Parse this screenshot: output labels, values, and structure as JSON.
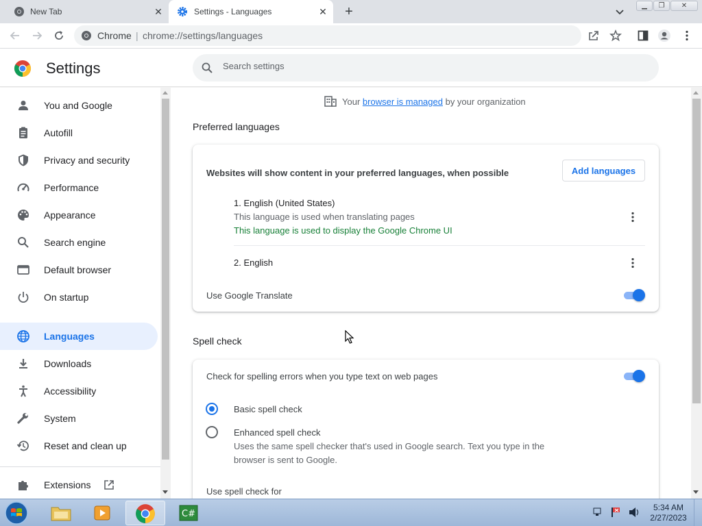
{
  "tabs": [
    {
      "title": "New Tab",
      "icon": "chrome-icon"
    },
    {
      "title": "Settings - Languages",
      "icon": "gear-icon"
    }
  ],
  "omnibox": {
    "site_label": "Chrome",
    "separator": "|",
    "url": "chrome://settings/languages"
  },
  "header": {
    "title": "Settings",
    "search_placeholder": "Search settings"
  },
  "sidebar": {
    "items": [
      {
        "label": "You and Google",
        "icon": "person-icon"
      },
      {
        "label": "Autofill",
        "icon": "clipboard-icon"
      },
      {
        "label": "Privacy and security",
        "icon": "shield-icon"
      },
      {
        "label": "Performance",
        "icon": "speedometer-icon"
      },
      {
        "label": "Appearance",
        "icon": "palette-icon"
      },
      {
        "label": "Search engine",
        "icon": "search-icon"
      },
      {
        "label": "Default browser",
        "icon": "browser-window-icon"
      },
      {
        "label": "On startup",
        "icon": "power-icon"
      },
      {
        "label": "Languages",
        "icon": "globe-icon",
        "active": true
      },
      {
        "label": "Downloads",
        "icon": "download-icon"
      },
      {
        "label": "Accessibility",
        "icon": "accessibility-icon"
      },
      {
        "label": "System",
        "icon": "wrench-icon"
      },
      {
        "label": "Reset and clean up",
        "icon": "history-icon"
      },
      {
        "label": "Extensions",
        "icon": "puzzle-icon"
      }
    ]
  },
  "managed": {
    "prefix": "Your",
    "link": "browser is managed",
    "suffix": "by your organization"
  },
  "preferred_languages": {
    "title": "Preferred languages",
    "description": "Websites will show content in your preferred languages, when possible",
    "add_button": "Add languages",
    "languages": [
      {
        "name": "1. English (United States)",
        "note1": "This language is used when translating pages",
        "note2": "This language is used to display the Google Chrome UI"
      },
      {
        "name": "2. English"
      }
    ],
    "translate_label": "Use Google Translate",
    "translate_on": true
  },
  "spell_check": {
    "title": "Spell check",
    "toggle_label": "Check for spelling errors when you type text on web pages",
    "toggle_on": true,
    "basic_label": "Basic spell check",
    "enhanced_label": "Enhanced spell check",
    "enhanced_desc1": "Uses the same spell checker that's used in Google search. Text you type in the",
    "enhanced_desc2": "browser is sent to Google.",
    "use_for_label": "Use spell check for",
    "selected": "basic"
  },
  "taskbar": {
    "time": "5:34 AM",
    "date": "2/27/2023"
  },
  "colors": {
    "accent": "#1a73e8",
    "active_nav_bg": "#e8f0fe",
    "green_note": "#188038"
  }
}
